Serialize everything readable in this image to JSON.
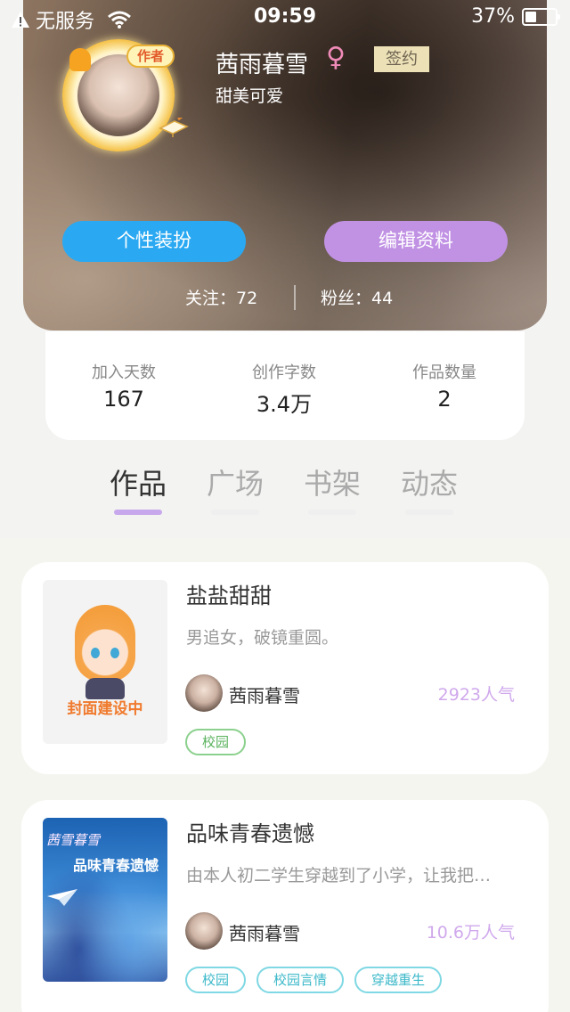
{
  "status_bar": {
    "carrier": "无服务",
    "time": "09:59",
    "battery": "37%"
  },
  "profile": {
    "nickname": "茜雨暮雪",
    "gender_symbol": "♀",
    "sign_tag": "签约",
    "bio": "甜美可爱",
    "avatar_badge": "作者",
    "dress_button": "个性装扮",
    "edit_button": "编辑资料",
    "following": "关注：72",
    "fans": "粉丝：44"
  },
  "stats": [
    {
      "label": "加入天数",
      "value": "167"
    },
    {
      "label": "创作字数",
      "value": "3.4万"
    },
    {
      "label": "作品数量",
      "value": "2"
    }
  ],
  "tabs": [
    "作品",
    "广场",
    "书架",
    "动态"
  ],
  "active_tab": "作品",
  "works": [
    {
      "title": "盐盐甜甜",
      "description": "男追女，破镜重圆。",
      "author": "茜雨暮雪",
      "popularity": "2923人气",
      "cover_text": "封面建设中",
      "tags": [
        "校园"
      ]
    },
    {
      "title": "品味青春遗憾",
      "description": "由本人初二学生穿越到了小学，让我把…",
      "author": "茜雨暮雪",
      "popularity": "10.6万人气",
      "cover_brand": "茜雪暮雪",
      "cover_title": "品味青春遗憾",
      "tags": [
        "校园",
        "校园言情",
        "穿越重生"
      ]
    }
  ],
  "colors": {
    "dress_button": "#2aa9f2",
    "edit_button": "#c192e4",
    "tab_underline": "#c7a8ec",
    "popularity": "#d0a9ec"
  }
}
